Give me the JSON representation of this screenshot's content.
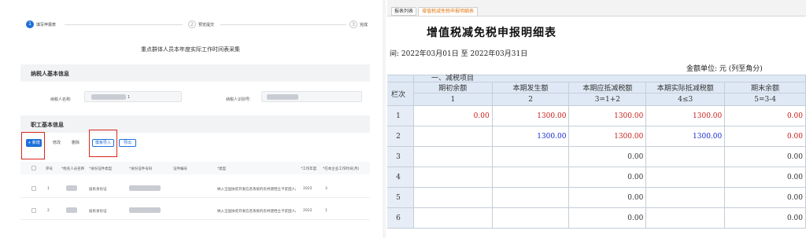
{
  "left_app": {
    "steps": [
      {
        "num": "1",
        "label": "填写申报表"
      },
      {
        "num": "2",
        "label": "预览提交"
      },
      {
        "num": "3",
        "label": "完成"
      }
    ],
    "page_title": "重点群体人员本年度实际工作时间表采集",
    "taxpayer_section": {
      "title": "纳税人基本信息",
      "name_label": "纳税人名称:",
      "name_value_suffix": "1",
      "id_label": "纳税人识别号:"
    },
    "employee_section": {
      "title": "职工基本信息",
      "buttons": {
        "add": "+ 新增",
        "modify": "修改",
        "delete": "删除",
        "import": "模板导入",
        "export": "导出"
      },
      "columns": [
        "序号",
        "*姓名人员名称",
        "*身份证件类型",
        "*身份证件号码",
        "证件编号",
        "*类型",
        "*工作年度",
        "*在本企业工作时间(月)"
      ],
      "rows": [
        {
          "index": "1",
          "id_type": "居民身份证",
          "category": "纳入全国扶贫开发信息系统的农村建档立卡贫困人员",
          "year": "2022",
          "months": "3"
        },
        {
          "index": "2",
          "id_type": "居民身份证",
          "category": "纳入全国扶贫开发信息系统的农村建档立卡贫困人员",
          "year": "2022",
          "months": "1"
        }
      ]
    }
  },
  "right_app": {
    "tabs": [
      {
        "label": "报表列表",
        "active": false
      },
      {
        "label": "增值税减免税申报明细表",
        "active": true
      }
    ],
    "title": "增值税减免税申报明细表",
    "period": "间: 2022年03月01日 至 2022年03月31日",
    "unit": "金额单位: 元 (列至角分)",
    "section_label": "一、减税项目",
    "row_header": "栏次",
    "columns": [
      {
        "name": "期初余额",
        "num": "1"
      },
      {
        "name": "本期发生额",
        "num": "2"
      },
      {
        "name": "本期应抵减税额",
        "num": "3=1+2"
      },
      {
        "name": "本期实际抵减税额",
        "num": "4≤3"
      },
      {
        "name": "期末余额",
        "num": "5=3-4"
      }
    ],
    "rows": [
      {
        "line": "1",
        "cells": [
          "0.00",
          "1300.00",
          "1300.00",
          "1300.00",
          "0.00"
        ]
      },
      {
        "line": "2",
        "cells": [
          "",
          "1300.00",
          "1300.00",
          "1300.00",
          "0.00"
        ]
      },
      {
        "line": "3",
        "cells": [
          "",
          "",
          "0.00",
          "",
          "0.00"
        ]
      },
      {
        "line": "4",
        "cells": [
          "",
          "",
          "0.00",
          "",
          "0.00"
        ]
      },
      {
        "line": "5",
        "cells": [
          "",
          "",
          "0.00",
          "",
          "0.00"
        ]
      },
      {
        "line": "6",
        "cells": [
          "",
          "",
          "0.00",
          "",
          "0.00"
        ]
      }
    ],
    "colors": {
      "red_value": "#c8201a",
      "blue_value": "#1a2bd0",
      "header_bg": "#dfe9f5"
    }
  }
}
